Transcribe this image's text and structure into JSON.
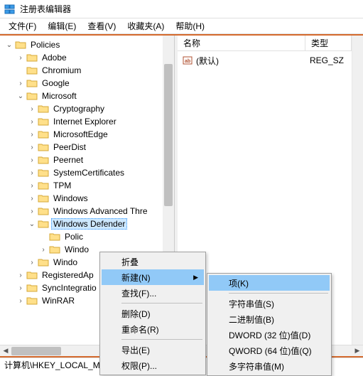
{
  "window": {
    "title": "注册表编辑器"
  },
  "menubar": {
    "file": "文件(F)",
    "edit": "编辑(E)",
    "view": "查看(V)",
    "favorites": "收藏夹(A)",
    "help": "帮助(H)"
  },
  "tree": {
    "root": "Policies",
    "items": [
      {
        "name": "Adobe",
        "expand": ">"
      },
      {
        "name": "Chromium",
        "expand": ""
      },
      {
        "name": "Google",
        "expand": ">"
      },
      {
        "name": "Microsoft",
        "expand": "v",
        "children": [
          {
            "name": "Cryptography",
            "expand": ">"
          },
          {
            "name": "Internet Explorer",
            "expand": ">"
          },
          {
            "name": "MicrosoftEdge",
            "expand": ">"
          },
          {
            "name": "PeerDist",
            "expand": ">"
          },
          {
            "name": "Peernet",
            "expand": ">"
          },
          {
            "name": "SystemCertificates",
            "expand": ">"
          },
          {
            "name": "TPM",
            "expand": ">"
          },
          {
            "name": "Windows",
            "expand": ">"
          },
          {
            "name": "Windows Advanced Thre",
            "expand": ">"
          },
          {
            "name": "Windows Defender",
            "expand": "v",
            "selected": true,
            "children": [
              {
                "name": "Polic",
                "expand": ""
              },
              {
                "name": "Windo",
                "expand": ">"
              }
            ]
          },
          {
            "name": "Windo",
            "expand": ">"
          }
        ]
      },
      {
        "name": "RegisteredAp",
        "expand": ">"
      },
      {
        "name": "SyncIntegratio",
        "expand": ">"
      },
      {
        "name": "WinRAR",
        "expand": ">"
      }
    ]
  },
  "list": {
    "header_name": "名称",
    "header_type": "类型",
    "row0_name": "(默认)",
    "row0_type": "REG_SZ"
  },
  "context_menu1": {
    "collapse": "折叠",
    "new": "新建(N)",
    "find": "查找(F)...",
    "delete": "删除(D)",
    "rename": "重命名(R)",
    "export": "导出(E)",
    "permissions": "权限(P)..."
  },
  "context_menu2": {
    "key": "项(K)",
    "string": "字符串值(S)",
    "binary": "二进制值(B)",
    "dword": "DWORD (32 位)值(D)",
    "qword": "QWORD (64 位)值(Q)",
    "multistring": "多字符串值(M)"
  },
  "statusbar": {
    "path": "计算机\\HKEY_LOCAL_M"
  }
}
